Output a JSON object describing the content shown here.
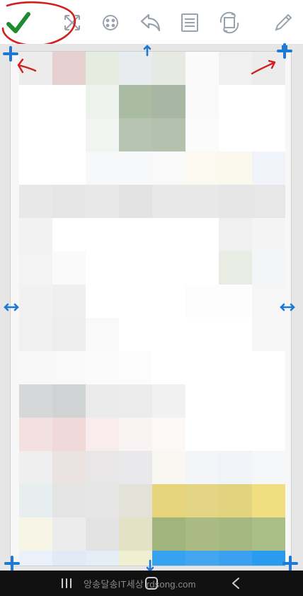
{
  "toolbar": {
    "icons": [
      "confirm-check-icon",
      "expand-icon",
      "focus-icon",
      "undo-icon",
      "print-icon",
      "rotate-icon",
      "edit-pencil-icon"
    ]
  },
  "colors": {
    "confirm": "#1e8c2e",
    "handle": "#1e78d6",
    "annotation": "#d21f1f"
  },
  "watermark": {
    "text": "앙송달송IT세상 rdsong.com"
  }
}
